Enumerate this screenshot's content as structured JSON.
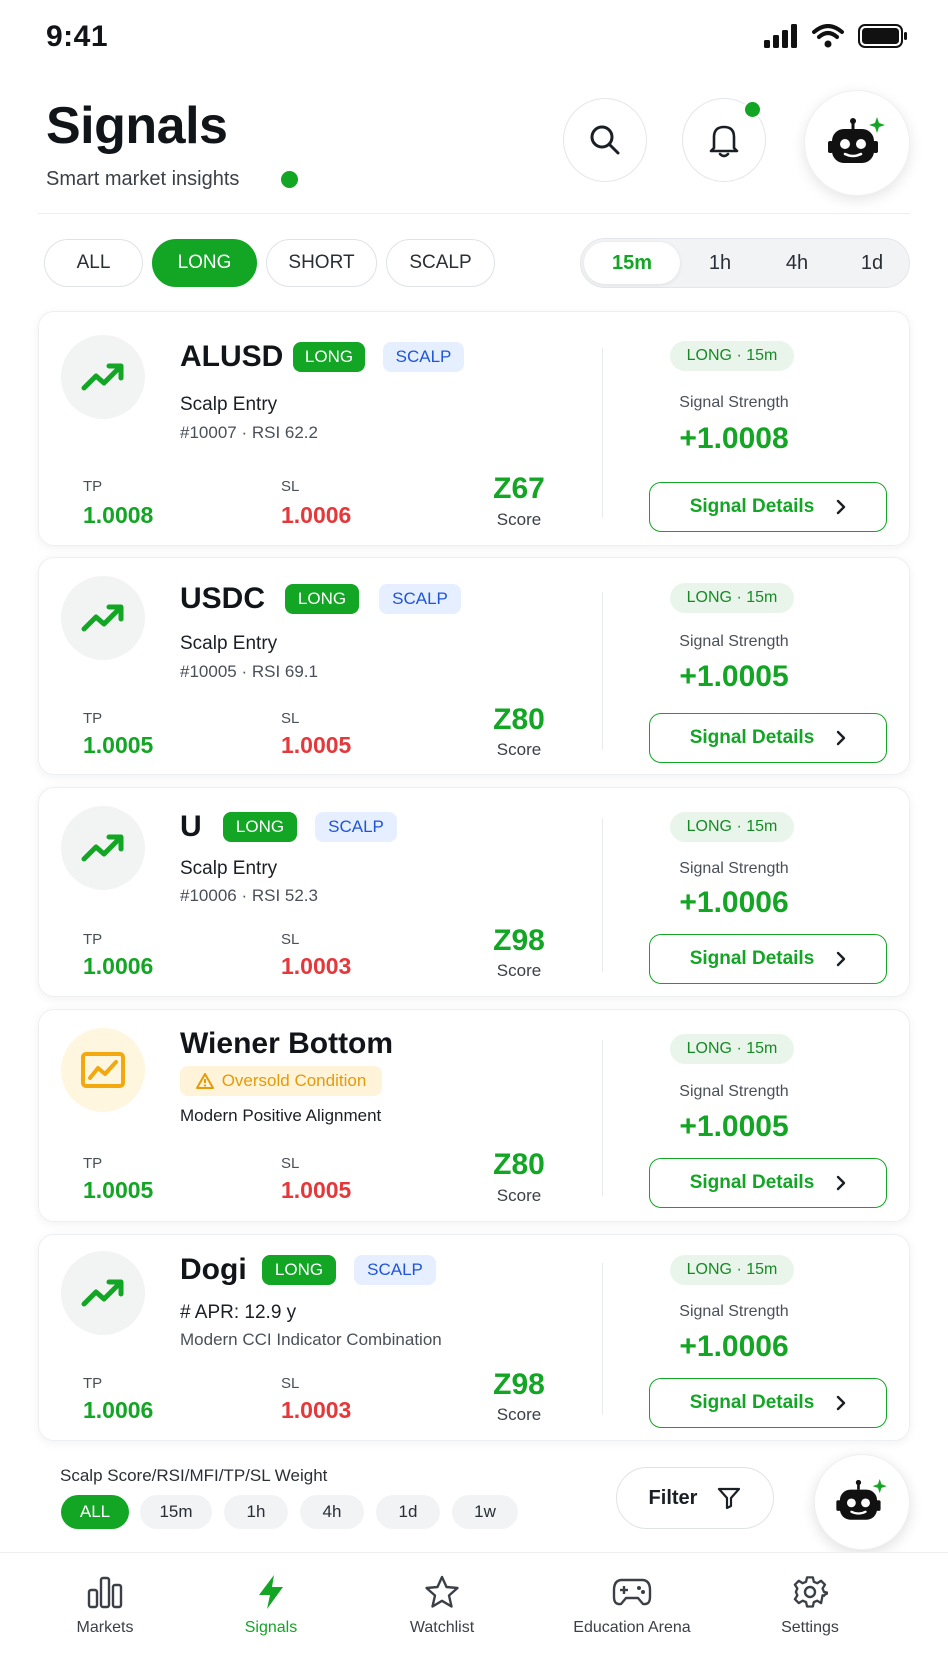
{
  "status": {
    "time": "9:41"
  },
  "header": {
    "title": "Signals",
    "subtitle": "Smart market insights"
  },
  "filters": {
    "types": [
      {
        "label": "ALL",
        "active": false
      },
      {
        "label": "LONG",
        "active": true
      },
      {
        "label": "SHORT",
        "active": false
      },
      {
        "label": "SCALP",
        "active": false
      }
    ],
    "timeframes": [
      {
        "label": "15m",
        "active": true
      },
      {
        "label": "1h",
        "active": false
      },
      {
        "label": "4h",
        "active": false
      },
      {
        "label": "1d",
        "active": false
      }
    ]
  },
  "common": {
    "tp_label": "TP",
    "sl_label": "SL",
    "score_label": "Score",
    "strength_label": "Signal Strength",
    "details_label": "Signal Details"
  },
  "cards": [
    {
      "name": "ALUSD",
      "badge1": "LONG",
      "badge2": "SCALP",
      "line1": "Scalp Entry",
      "line2": "#10007 · RSI 62.2",
      "tp": "1.0008",
      "sl": "1.0006",
      "score": "Z67",
      "tf_pill": "LONG · 15m",
      "strength": "+1.0008",
      "icon": "trending-up-icon"
    },
    {
      "name": "USDC",
      "badge1": "LONG",
      "badge2": "SCALP",
      "line1": "Scalp Entry",
      "line2": "#10005 · RSI 69.1",
      "tp": "1.0005",
      "sl": "1.0005",
      "score": "Z80",
      "tf_pill": "LONG · 15m",
      "strength": "+1.0005",
      "icon": "trending-up-icon"
    },
    {
      "name": "U",
      "badge1": "LONG",
      "badge2": "SCALP",
      "line1": "Scalp Entry",
      "line2": "#10006 · RSI 52.3",
      "tp": "1.0006",
      "sl": "1.0003",
      "score": "Z98",
      "tf_pill": "LONG · 15m",
      "strength": "+1.0006",
      "icon": "trending-up-icon"
    },
    {
      "name": "Wiener Bottom",
      "warning": "Oversold Condition",
      "line1": "Modern Positive Alignment",
      "tp": "1.0005",
      "sl": "1.0005",
      "score": "Z80",
      "tf_pill": "LONG · 15m",
      "strength": "+1.0005",
      "icon": "chart-frame-icon"
    },
    {
      "name": "Dogi",
      "badge1": "LONG",
      "badge2": "SCALP",
      "line1": "# APR: 12.9 y",
      "line2": "Modern CCI Indicator Combination",
      "tp": "1.0006",
      "sl": "1.0003",
      "score": "Z98",
      "tf_pill": "LONG · 15m",
      "strength": "+1.0006",
      "icon": "trending-up-icon"
    }
  ],
  "weight": {
    "title": "Scalp Score/RSI/MFI/TP/SL Weight",
    "chips": [
      "ALL",
      "15m",
      "1h",
      "4h",
      "1d",
      "1w"
    ],
    "filter_label": "Filter"
  },
  "nav": [
    {
      "label": "Markets",
      "icon": "bar-chart-icon",
      "active": false
    },
    {
      "label": "Signals",
      "icon": "lightning-icon",
      "active": true
    },
    {
      "label": "Watchlist",
      "icon": "star-icon",
      "active": false
    },
    {
      "label": "Education Arena",
      "icon": "gamepad-icon",
      "active": false
    },
    {
      "label": "Settings",
      "icon": "gear-icon",
      "active": false
    }
  ],
  "colors": {
    "accent": "#13a524",
    "loss": "#e5383b",
    "scalp": "#1f55d6",
    "warning": "#e49b08"
  }
}
